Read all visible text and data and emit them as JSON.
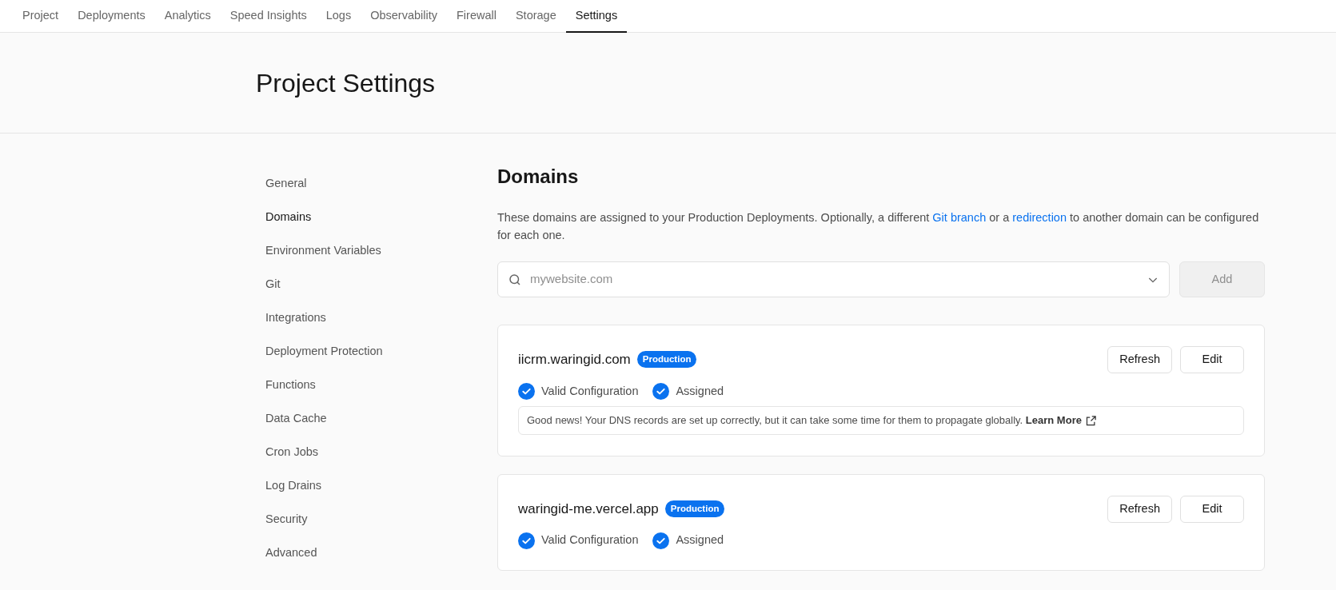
{
  "tabs": [
    {
      "label": "Project",
      "selected": false
    },
    {
      "label": "Deployments",
      "selected": false
    },
    {
      "label": "Analytics",
      "selected": false
    },
    {
      "label": "Speed Insights",
      "selected": false
    },
    {
      "label": "Logs",
      "selected": false
    },
    {
      "label": "Observability",
      "selected": false
    },
    {
      "label": "Firewall",
      "selected": false
    },
    {
      "label": "Storage",
      "selected": false
    },
    {
      "label": "Settings",
      "selected": true
    }
  ],
  "page_title": "Project Settings",
  "sidebar": {
    "items": [
      {
        "label": "General",
        "selected": false
      },
      {
        "label": "Domains",
        "selected": true
      },
      {
        "label": "Environment Variables",
        "selected": false
      },
      {
        "label": "Git",
        "selected": false
      },
      {
        "label": "Integrations",
        "selected": false
      },
      {
        "label": "Deployment Protection",
        "selected": false
      },
      {
        "label": "Functions",
        "selected": false
      },
      {
        "label": "Data Cache",
        "selected": false
      },
      {
        "label": "Cron Jobs",
        "selected": false
      },
      {
        "label": "Log Drains",
        "selected": false
      },
      {
        "label": "Security",
        "selected": false
      },
      {
        "label": "Advanced",
        "selected": false
      }
    ]
  },
  "section": {
    "title": "Domains",
    "description": [
      "These domains are assigned to your Production Deployments. Optionally, a different ",
      "Git branch",
      " or a ",
      "redirection",
      " to another domain can be configured for each one."
    ],
    "domain_input": {
      "placeholder": "mywebsite.com"
    },
    "add_button": {
      "label": "Add",
      "disabled": true
    }
  },
  "domains": [
    {
      "name": "iicrm.waringid.com",
      "badge": "Production",
      "checks": [
        "Valid Configuration",
        "Assigned"
      ],
      "note": {
        "text": "Good news! Your DNS records are set up correctly, but it can take some time for them to propagate globally.",
        "link": "Learn More"
      },
      "buttons": [
        "Refresh",
        "Edit"
      ]
    },
    {
      "name": "waringid-me.vercel.app",
      "badge": "Production",
      "checks": [
        "Valid Configuration",
        "Assigned"
      ],
      "buttons": [
        "Refresh",
        "Edit"
      ]
    }
  ]
}
